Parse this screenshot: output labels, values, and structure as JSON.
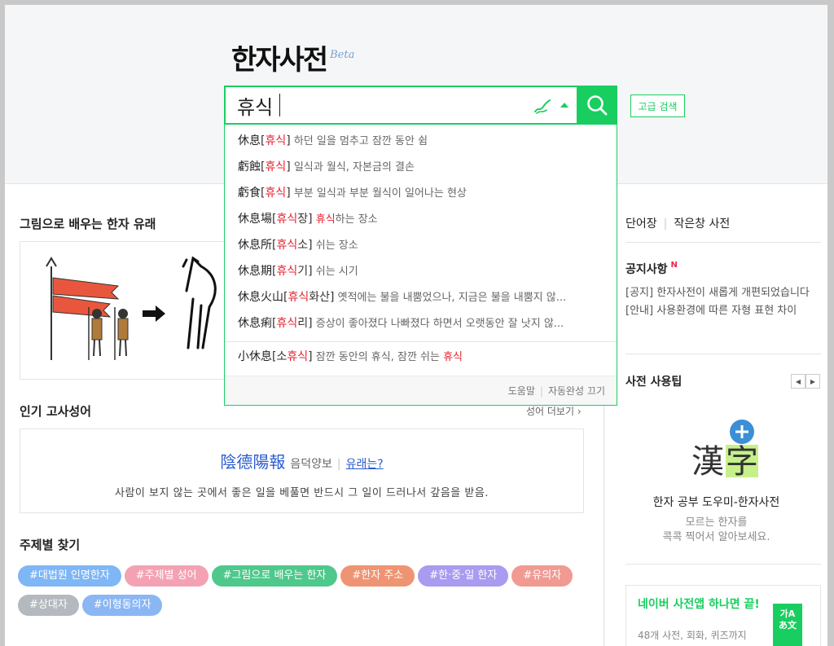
{
  "logo": {
    "title": "한자사전",
    "beta": "Beta"
  },
  "search": {
    "value": "휴식",
    "advanced_label": "고급 검색"
  },
  "autocomplete": {
    "items": [
      {
        "hanja": "休息",
        "reading": "휴식",
        "reading_suffix": "",
        "desc_pre": "",
        "desc_hl": "",
        "desc": "하던 일을 멈추고 잠깐 동안 쉼"
      },
      {
        "hanja": "虧蝕",
        "reading": "휴식",
        "reading_suffix": "",
        "desc_pre": "",
        "desc_hl": "",
        "desc": "일식과 월식, 자본금의 결손"
      },
      {
        "hanja": "虧食",
        "reading": "휴식",
        "reading_suffix": "",
        "desc_pre": "",
        "desc_hl": "",
        "desc": "부분 일식과 부분 월식이 일어나는 현상"
      },
      {
        "hanja": "休息場",
        "reading": "휴식",
        "reading_suffix": "장",
        "desc_pre": "",
        "desc_hl": "휴식",
        "desc": "하는 장소"
      },
      {
        "hanja": "休息所",
        "reading": "휴식",
        "reading_suffix": "소",
        "desc_pre": "",
        "desc_hl": "",
        "desc": "쉬는 장소"
      },
      {
        "hanja": "休息期",
        "reading": "휴식",
        "reading_suffix": "기",
        "desc_pre": "",
        "desc_hl": "",
        "desc": "쉬는 시기"
      },
      {
        "hanja": "休息火山",
        "reading": "휴식",
        "reading_suffix": "화산",
        "desc_pre": "",
        "desc_hl": "",
        "desc": "옛적에는 불을 내뿜었으나, 지금은 불을 내뿜지 않..."
      },
      {
        "hanja": "休息痢",
        "reading": "휴식",
        "reading_suffix": "리",
        "desc_pre": "",
        "desc_hl": "",
        "desc": "증상이 좋아졌다 나빠졌다 하면서 오랫동안 잘 낫지 않..."
      }
    ],
    "extra": {
      "hanja": "小休息",
      "reading_prefix": "소",
      "reading": "휴식",
      "desc": "잠깐 동안의 휴식, 잠깐 쉬는 ",
      "desc_hl": "휴식"
    },
    "footer": {
      "help": "도움말",
      "toggle": "자동완성 끄기"
    }
  },
  "origin": {
    "title": "그림으로 배우는 한자 유래"
  },
  "idiom": {
    "title": "인기 고사성어",
    "more": "성어 더보기",
    "hanja": "陰德陽報",
    "reading": "음덕양보",
    "link": "유래는?",
    "meaning": "사람이 보지 않는 곳에서 좋은 일을 베풀면 반드시 그 일이 드러나서 갚음을 받음."
  },
  "topics": {
    "title": "주제별 찾기",
    "tags": [
      {
        "label": "#대법원 인명한자",
        "color": "#7fb6f5"
      },
      {
        "label": "#주제별 성어",
        "color": "#f4a2b3"
      },
      {
        "label": "#그림으로 배우는 한자",
        "color": "#4fc88b"
      },
      {
        "label": "#한자 주소",
        "color": "#ef9472"
      },
      {
        "label": "#한·중·일 한자",
        "color": "#a99bf0"
      },
      {
        "label": "#유의자",
        "color": "#f09a92"
      },
      {
        "label": "#상대자",
        "color": "#b3b9be"
      },
      {
        "label": "#이형동의자",
        "color": "#8ab6f3"
      }
    ]
  },
  "right": {
    "links": [
      "단어장",
      "작은창 사전"
    ],
    "notice": {
      "title": "공지사항",
      "new": "N",
      "items": [
        "[공지] 한자사전이 새롭게 개편되었습니다",
        "[안내] 사용환경에 따른 자형 표현 차이"
      ]
    },
    "tip": {
      "title": "사전 사용팁",
      "logo_char1": "漢",
      "logo_char2": "字",
      "caption": "한자 공부 도우미-한자사전",
      "desc1": "모르는 한자를",
      "desc2": "콕콕 찍어서 알아보세요."
    },
    "app": {
      "title": "네이버 사전앱 하나면 끝!",
      "desc": "48개 사전, 회화, 퀴즈까지",
      "icon_line1": "가A",
      "icon_line2": "あ文"
    }
  },
  "colors": {
    "accent": "#19ce60",
    "highlight": "#e6232f",
    "link": "#2a5ccf"
  }
}
